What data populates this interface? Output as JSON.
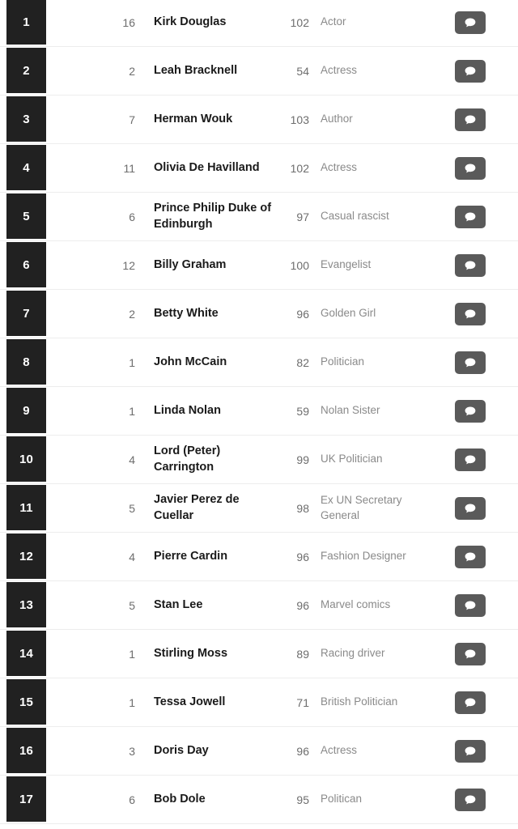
{
  "list": {
    "action_icon": "comment-bubble-icon",
    "action_button_color": "#5a5a5a",
    "rank_badge_color": "#212121",
    "row_separator_color": "#ededed",
    "rows": [
      {
        "rank": "1",
        "count": "16",
        "name": "Kirk Douglas",
        "age": "102",
        "description": "Actor"
      },
      {
        "rank": "2",
        "count": "2",
        "name": "Leah Bracknell",
        "age": "54",
        "description": "Actress"
      },
      {
        "rank": "3",
        "count": "7",
        "name": "Herman Wouk",
        "age": "103",
        "description": "Author"
      },
      {
        "rank": "4",
        "count": "11",
        "name": "Olivia De Havilland",
        "age": "102",
        "description": "Actress"
      },
      {
        "rank": "5",
        "count": "6",
        "name": "Prince Philip Duke of Edinburgh",
        "age": "97",
        "description": "Casual rascist"
      },
      {
        "rank": "6",
        "count": "12",
        "name": "Billy Graham",
        "age": "100",
        "description": "Evangelist"
      },
      {
        "rank": "7",
        "count": "2",
        "name": "Betty White",
        "age": "96",
        "description": "Golden Girl"
      },
      {
        "rank": "8",
        "count": "1",
        "name": "John McCain",
        "age": "82",
        "description": "Politician"
      },
      {
        "rank": "9",
        "count": "1",
        "name": "Linda Nolan",
        "age": "59",
        "description": "Nolan Sister"
      },
      {
        "rank": "10",
        "count": "4",
        "name": "Lord (Peter) Carrington",
        "age": "99",
        "description": "UK Politician"
      },
      {
        "rank": "11",
        "count": "5",
        "name": "Javier Perez de Cuellar",
        "age": "98",
        "description": "Ex UN Secretary General"
      },
      {
        "rank": "12",
        "count": "4",
        "name": "Pierre Cardin",
        "age": "96",
        "description": "Fashion Designer"
      },
      {
        "rank": "13",
        "count": "5",
        "name": "Stan Lee",
        "age": "96",
        "description": "Marvel comics"
      },
      {
        "rank": "14",
        "count": "1",
        "name": "Stirling Moss",
        "age": "89",
        "description": "Racing driver"
      },
      {
        "rank": "15",
        "count": "1",
        "name": "Tessa Jowell",
        "age": "71",
        "description": "British Politician"
      },
      {
        "rank": "16",
        "count": "3",
        "name": "Doris Day",
        "age": "96",
        "description": "Actress"
      },
      {
        "rank": "17",
        "count": "6",
        "name": "Bob Dole",
        "age": "95",
        "description": "Politican"
      }
    ]
  }
}
